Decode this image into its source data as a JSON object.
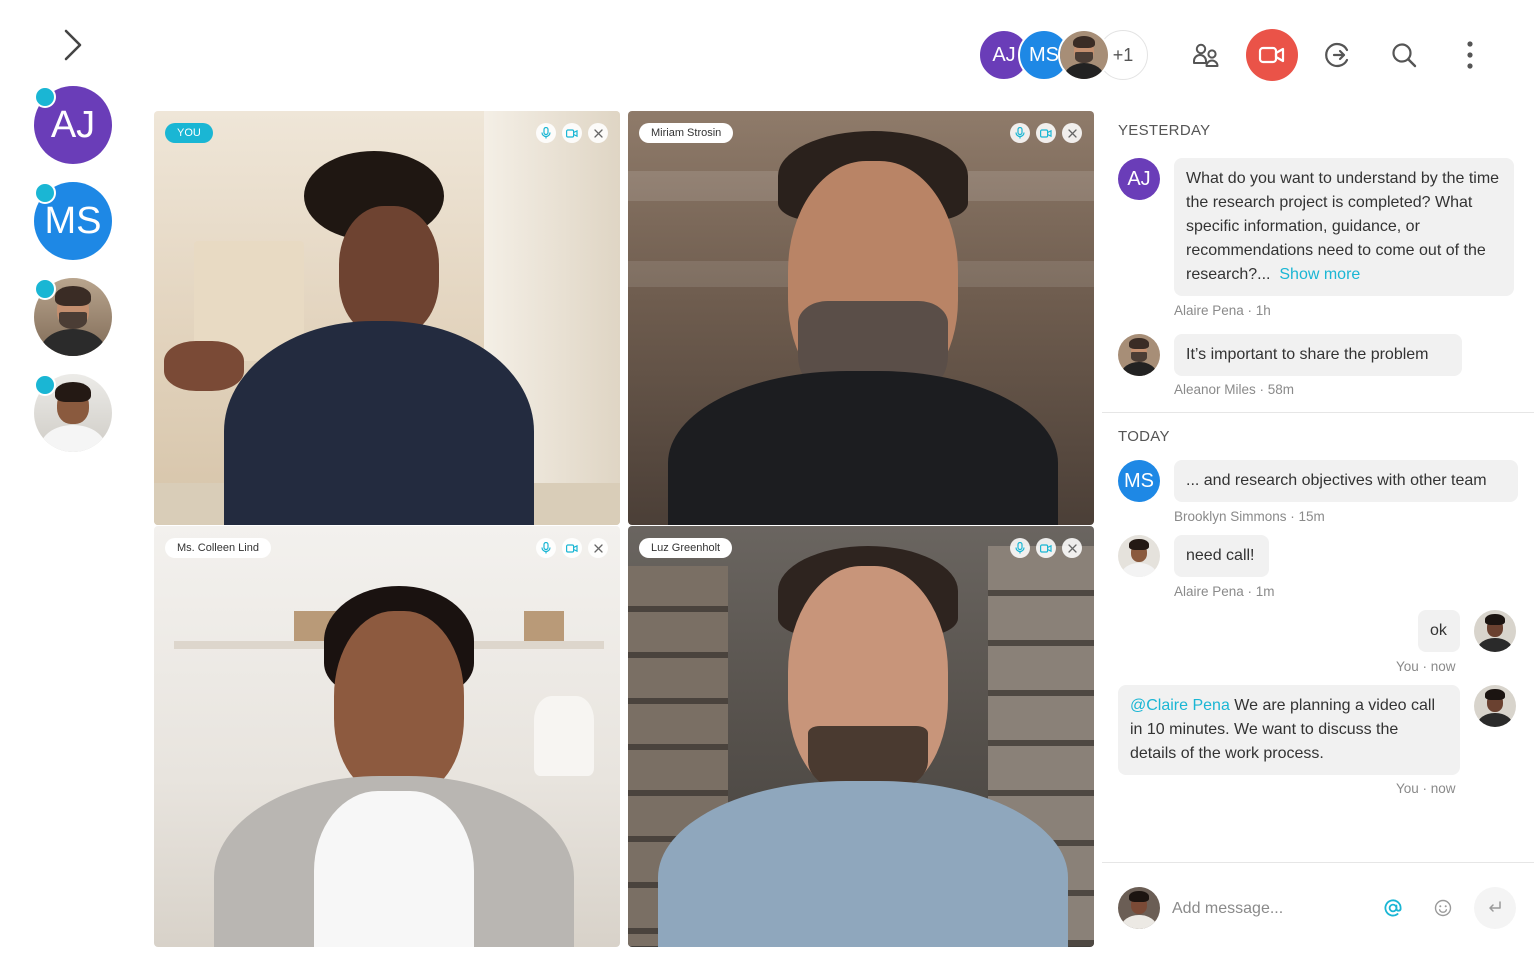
{
  "colors": {
    "accent": "#1ab6d4",
    "record": "#ea5348",
    "aj": "#6a3db8",
    "ms": "#1e88e5",
    "bubble": "#f1f1f1"
  },
  "sidebar": {
    "toggle_icon": "chevron-right-icon",
    "items": [
      {
        "initials": "AJ"
      },
      {
        "initials": "MS"
      },
      {
        "photo": "man-beard"
      },
      {
        "photo": "woman-smiling"
      }
    ]
  },
  "topbar": {
    "participants": [
      "AJ",
      "MS"
    ],
    "overflow": "+1",
    "icons": [
      "participants-icon",
      "video-camera-icon",
      "share-screen-icon",
      "search-icon",
      "more-vertical-icon"
    ]
  },
  "videos": [
    {
      "name": "You",
      "is_self": true
    },
    {
      "name": "Miriam Strosin"
    },
    {
      "name": "Ms. Colleen Lind"
    },
    {
      "name": "Luz Greenholt"
    }
  ],
  "chat": {
    "yesterday_label": "YESTERDAY",
    "today_label": "TODAY",
    "messages": [
      {
        "initials": "AJ",
        "text": "What do you want to understand by the time the research project is completed? What specific information, guidance, or recommendations need to come out of the research?...",
        "show_more": "Show more",
        "meta": "Alaire Pena · 1h"
      },
      {
        "text": "It’s important to share the problem",
        "meta": "Aleanor Miles · 58m"
      },
      {
        "initials": "MS",
        "text": "... and research objectives with other team",
        "meta": "Brooklyn Simmons · 15m"
      },
      {
        "text": "need call!",
        "meta": "Alaire Pena · 1m"
      },
      {
        "text": "ok",
        "meta": "You · now"
      },
      {
        "mention": "@Claire Pena",
        "text": " We are planning a video call in 10 minutes. We want to discuss the details of the work process.",
        "meta": "You · now"
      }
    ],
    "composer": {
      "placeholder": "Add message..."
    }
  }
}
